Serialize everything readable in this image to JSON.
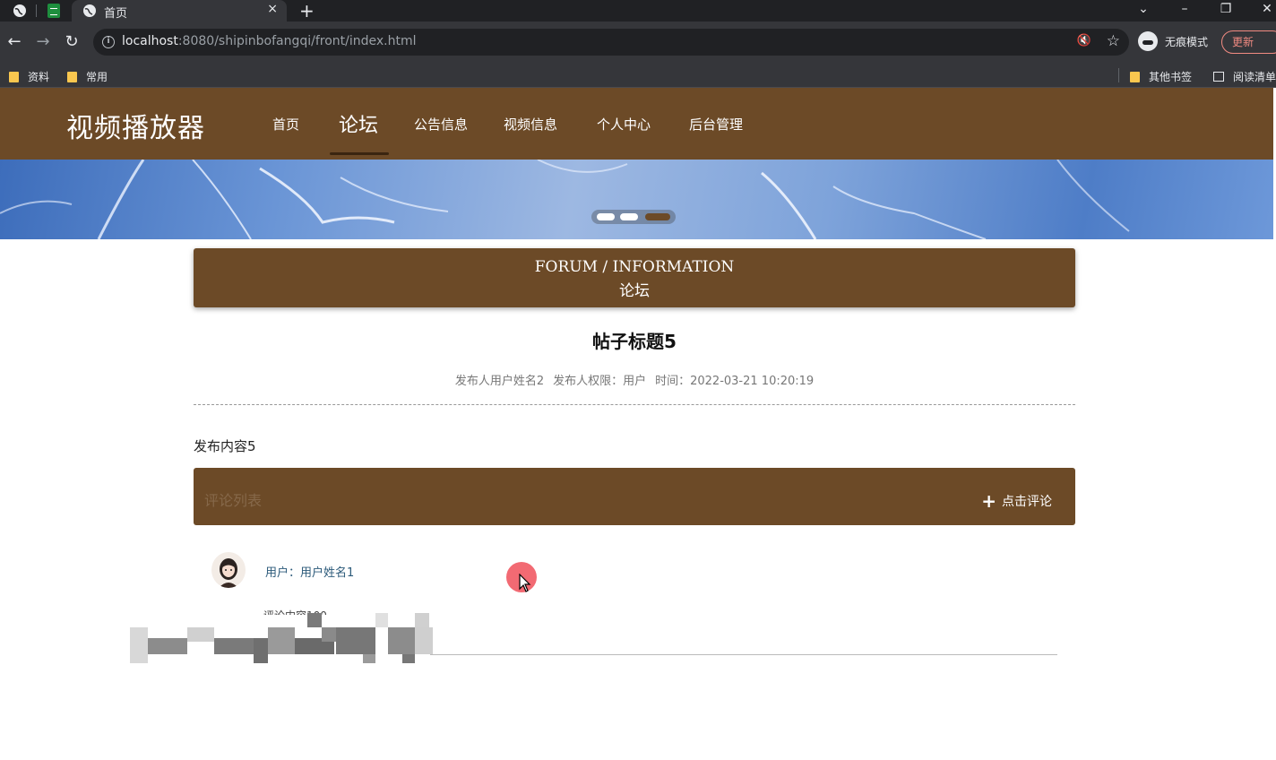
{
  "browser": {
    "tab_title": "首页",
    "tab_close": "×",
    "new_tab": "+",
    "url_host": "localhost",
    "url_path": ":8080/shipinbofangqi/front/index.html",
    "incognito_label": "无痕模式",
    "update_label": "更新",
    "bookmarks": [
      "资料",
      "常用"
    ],
    "bookmarks_right": [
      "其他书签",
      "阅读清单"
    ]
  },
  "site": {
    "logo": "视频播放器",
    "nav": [
      "首页",
      "论坛",
      "公告信息",
      "视频信息",
      "个人中心",
      "后台管理"
    ],
    "active_nav": "论坛"
  },
  "section": {
    "title_en": "FORUM / INFORMATION",
    "title_zh": "论坛"
  },
  "post": {
    "title": "帖子标题5",
    "author": "发布人用户姓名2",
    "role": "发布人权限：用户",
    "time": "时间：2022-03-21 10:20:19",
    "content": "发布内容5"
  },
  "comments_bar": {
    "label": "评论列表",
    "add_label": "点击评论",
    "add_icon": "plus-icon"
  },
  "comments": [
    {
      "user": "用户：用户姓名1",
      "content": "评论内容100"
    }
  ],
  "colors": {
    "brand_brown": "#6c4a27",
    "banner_blue": "#6a95d6",
    "cursor_highlight": "#f0505a"
  }
}
